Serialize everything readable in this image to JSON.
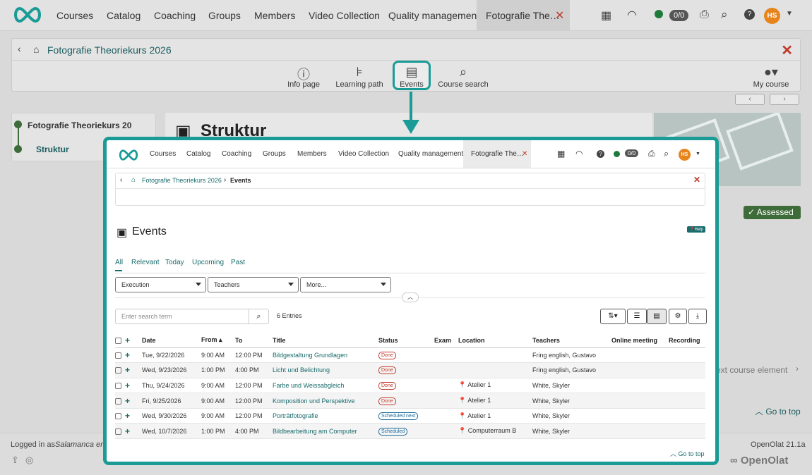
{
  "bg_nav": {
    "items": [
      "Courses",
      "Catalog",
      "Coaching",
      "Groups",
      "Members",
      "Video Collection",
      "Quality management"
    ],
    "active_tab": "Fotografie The…",
    "count_pill": "0/0",
    "avatar": "HS"
  },
  "course": {
    "title": "Fotografie Theoriekurs 2026",
    "tools": [
      "Info page",
      "Learning path",
      "Events",
      "Course search"
    ],
    "my_course": "My course"
  },
  "tree": {
    "root": "Fotografie Theoriekurs 20",
    "child": "Struktur"
  },
  "struktur_heading": "Struktur",
  "assessed_label": "Assessed",
  "bg_right": {
    "next_element": "ext course element",
    "go_to_top": "Go to top"
  },
  "footer": {
    "logged_in": "Logged in as",
    "user": "Salamanca eng",
    "version": "OpenOlat 21.1a",
    "brand": "OpenOlat"
  },
  "overlay": {
    "nav": [
      "Courses",
      "Catalog",
      "Coaching",
      "Groups",
      "Members",
      "Video Collection",
      "Quality management"
    ],
    "active_tab": "Fotografie The…",
    "count_pill": "0/0",
    "avatar": "HS",
    "breadcrumb": {
      "course": "Fotografie Theoriekurs 2026",
      "current": "Events"
    },
    "heading": "Events",
    "help": "Help",
    "tabs": [
      "All",
      "Relevant",
      "Today",
      "Upcoming",
      "Past"
    ],
    "filters": [
      "Execution",
      "Teachers",
      "More..."
    ],
    "search_placeholder": "Enter search term",
    "entries": "6 Entries",
    "columns": [
      "Date",
      "From",
      "To",
      "Title",
      "Status",
      "Exam",
      "Location",
      "Teachers",
      "Online meeting",
      "Recording"
    ],
    "rows": [
      {
        "date": "Tue, 9/22/2026",
        "from": "9:00 AM",
        "to": "12:00 PM",
        "title": "Bildgestaltung Grundlagen",
        "status": "Done",
        "location": "",
        "teachers": "Fring english, Gustavo"
      },
      {
        "date": "Wed, 9/23/2026",
        "from": "1:00 PM",
        "to": "4:00 PM",
        "title": "Licht und Belichtung",
        "status": "Done",
        "location": "",
        "teachers": "Fring english, Gustavo"
      },
      {
        "date": "Thu, 9/24/2026",
        "from": "9:00 AM",
        "to": "12:00 PM",
        "title": "Farbe und Weissabgleich",
        "status": "Done",
        "location": "Atelier 1",
        "teachers": "White, Skyler"
      },
      {
        "date": "Fri, 9/25/2026",
        "from": "9:00 AM",
        "to": "12:00 PM",
        "title": "Komposition und Perspektive",
        "status": "Done",
        "location": "Atelier 1",
        "teachers": "White, Skyler"
      },
      {
        "date": "Wed, 9/30/2026",
        "from": "9:00 AM",
        "to": "12:00 PM",
        "title": "Porträtfotografie",
        "status": "Scheduled next",
        "location": "Atelier 1",
        "teachers": "White, Skyler"
      },
      {
        "date": "Wed, 10/7/2026",
        "from": "1:00 PM",
        "to": "4:00 PM",
        "title": "Bildbearbeitung am Computer",
        "status": "Scheduled",
        "location": "Computerraum B",
        "teachers": "White, Skyler"
      }
    ],
    "go_to_top": "Go to top"
  },
  "colors": {
    "accent": "#1a9b96",
    "link": "#1a6b6c",
    "close": "#c0392b",
    "assessed": "#3e6b3a"
  }
}
